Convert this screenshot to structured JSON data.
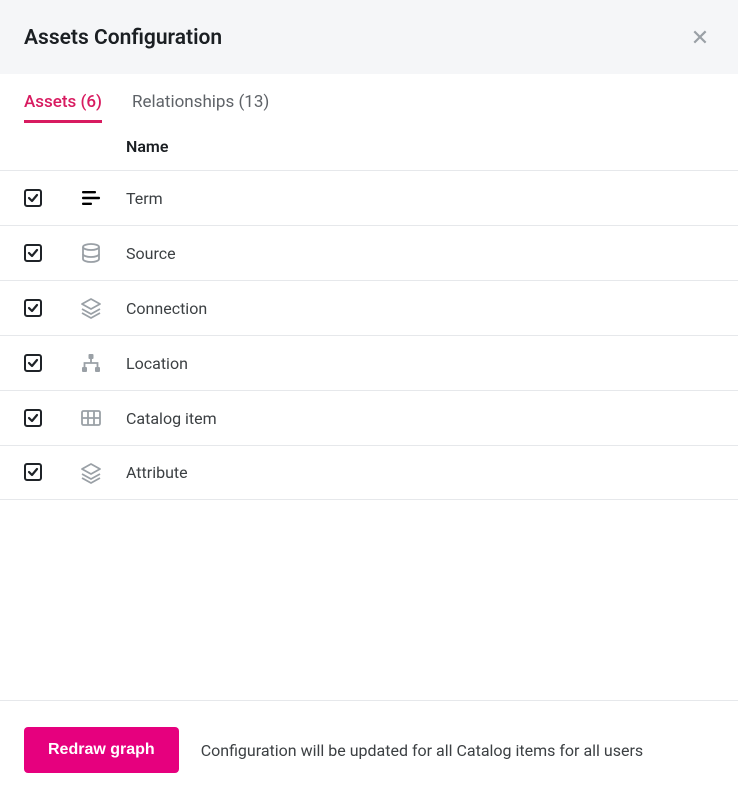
{
  "dialog": {
    "title": "Assets Configuration"
  },
  "tabs": {
    "assets": {
      "label": "Assets (6)",
      "active": true
    },
    "relationships": {
      "label": "Relationships (13)",
      "active": false
    }
  },
  "table": {
    "header_name": "Name"
  },
  "assets": [
    {
      "name": "Term",
      "icon": "text-lines-icon",
      "checked": true
    },
    {
      "name": "Source",
      "icon": "database-icon",
      "checked": true
    },
    {
      "name": "Connection",
      "icon": "layers-icon",
      "checked": true
    },
    {
      "name": "Location",
      "icon": "hierarchy-icon",
      "checked": true
    },
    {
      "name": "Catalog item",
      "icon": "grid-icon",
      "checked": true
    },
    {
      "name": "Attribute",
      "icon": "layers-icon",
      "checked": true
    }
  ],
  "footer": {
    "button": "Redraw graph",
    "note": "Configuration will be updated for all Catalog items for all users"
  },
  "colors": {
    "accent": "#e6007e",
    "tab_active": "#d81b60",
    "border": "#e6e8eb",
    "muted_icon": "#9aa0a6"
  }
}
